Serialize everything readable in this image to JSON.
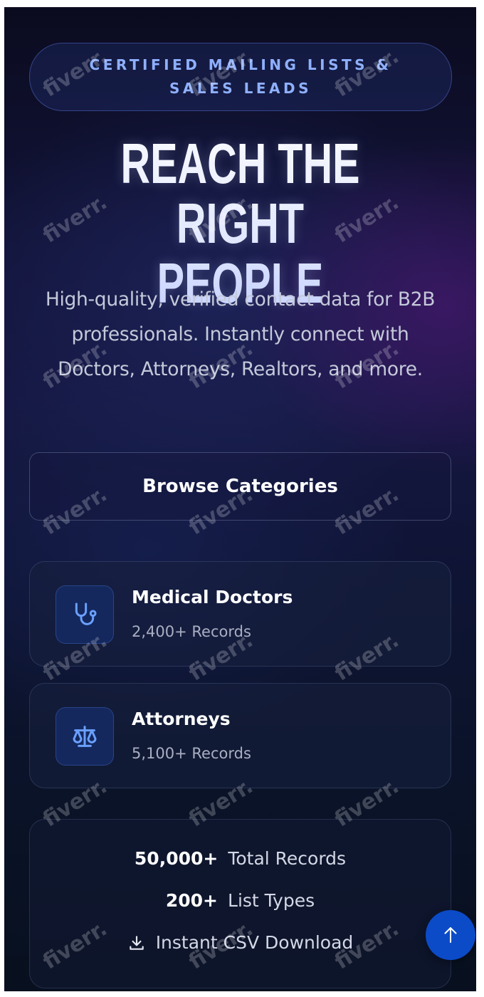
{
  "hero": {
    "badge": "CERTIFIED MAILING LISTS & SALES LEADS",
    "headline_line1": "REACH THE RIGHT",
    "headline_line2": "PEOPLE",
    "subtitle": "High-quality, verified contact data for B2B professionals. Instantly connect with Doctors, Attorneys, Realtors, and more."
  },
  "browse_button": {
    "label": "Browse Categories"
  },
  "categories": [
    {
      "title": "Medical Doctors",
      "count": "2,400+ Records",
      "icon": "stethoscope-icon"
    },
    {
      "title": "Attorneys",
      "count": "5,100+ Records",
      "icon": "scales-icon"
    }
  ],
  "stats": {
    "total_value": "50,000+",
    "total_label": "Total Records",
    "types_value": "200+",
    "types_label": "List Types",
    "download_label": "Instant CSV Download",
    "download_icon": "download-icon"
  },
  "scroll_top": {
    "icon": "arrow-up-icon"
  },
  "watermark": "fiverr.",
  "colors": {
    "accent": "#8fb0ff",
    "button_blue": "#0b4bc8",
    "icon_box": "#14285e",
    "icon_stroke": "#6aa0ff"
  }
}
